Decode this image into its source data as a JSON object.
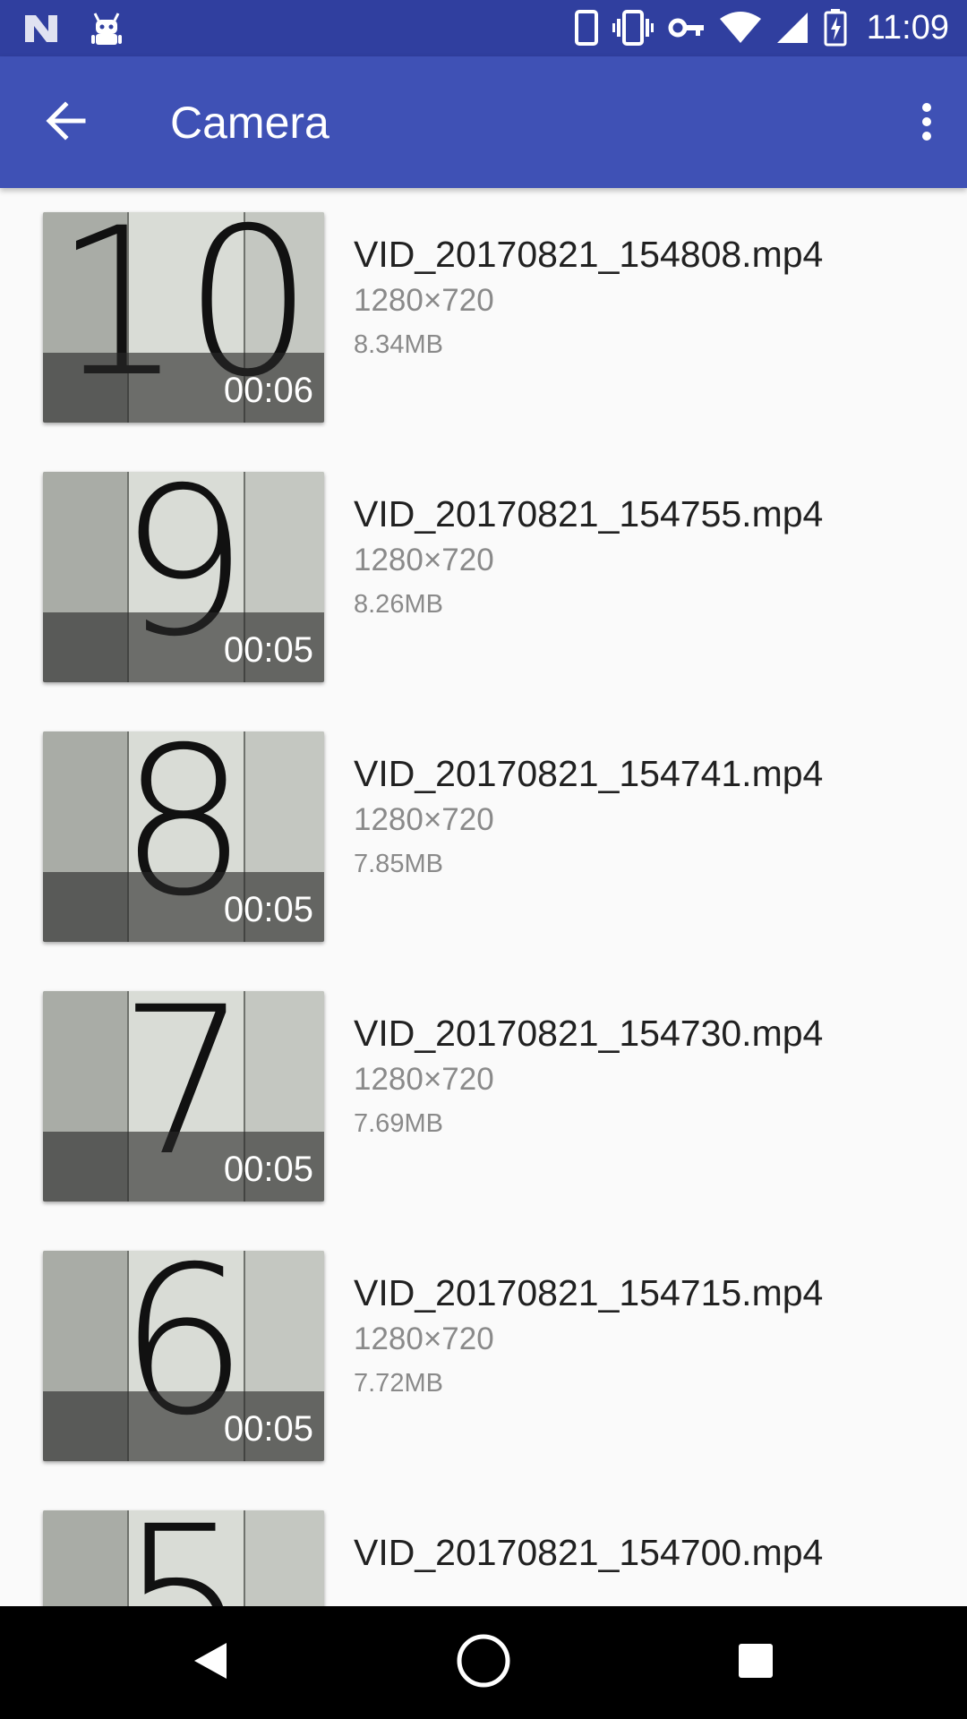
{
  "status_bar": {
    "time": "11:09",
    "icons": [
      "notification-n-icon",
      "android-robot-icon",
      "phone-outline-icon",
      "vibrate-icon",
      "vpn-key-icon",
      "wifi-icon",
      "cellular-signal-icon",
      "battery-charging-icon"
    ]
  },
  "app_bar": {
    "title": "Camera",
    "back_icon": "arrow-back-icon",
    "overflow_icon": "more-vert-icon"
  },
  "videos": [
    {
      "name": "VID_20170821_154808.mp4",
      "resolution": "1280×720",
      "size": "8.34MB",
      "duration": "00:06",
      "thumb_digit": "10"
    },
    {
      "name": "VID_20170821_154755.mp4",
      "resolution": "1280×720",
      "size": "8.26MB",
      "duration": "00:05",
      "thumb_digit": "9"
    },
    {
      "name": "VID_20170821_154741.mp4",
      "resolution": "1280×720",
      "size": "7.85MB",
      "duration": "00:05",
      "thumb_digit": "8"
    },
    {
      "name": "VID_20170821_154730.mp4",
      "resolution": "1280×720",
      "size": "7.69MB",
      "duration": "00:05",
      "thumb_digit": "7"
    },
    {
      "name": "VID_20170821_154715.mp4",
      "resolution": "1280×720",
      "size": "7.72MB",
      "duration": "00:05",
      "thumb_digit": "6"
    },
    {
      "name": "VID_20170821_154700.mp4",
      "resolution": "",
      "size": "",
      "duration": "",
      "thumb_digit": "5"
    }
  ],
  "nav_bar": {
    "icons": [
      "back-triangle-icon",
      "home-circle-icon",
      "recents-square-icon"
    ]
  },
  "colors": {
    "status_bar": "#303f9f",
    "app_bar": "#3f51b5",
    "background": "#fafafa",
    "nav_bar": "#000000"
  }
}
